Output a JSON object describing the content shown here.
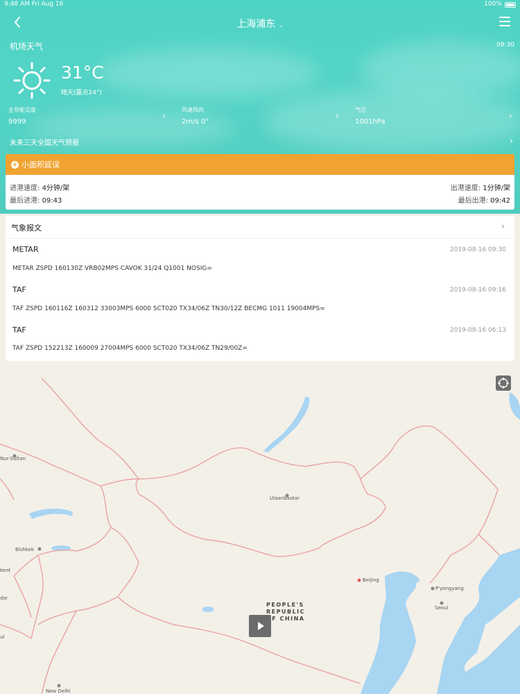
{
  "status_bar": {
    "time_date": "9:48 AM   Fri Aug 16",
    "battery": "100%"
  },
  "header": {
    "title": "上海浦东",
    "section_label": "机场天气",
    "update_time": "09:30"
  },
  "weather": {
    "temperature": "31°C",
    "condition": "晴天(露点24°)",
    "icon": "sun-icon",
    "metrics": [
      {
        "label": "主导能见度",
        "value": "9999"
      },
      {
        "label": "风速风向",
        "value": "2m/s 0°"
      },
      {
        "label": "气压",
        "value": "1001hPa"
      }
    ],
    "forecast_link": "未来三天全国天气预报"
  },
  "delay": {
    "title": "小面积延误",
    "arr_speed_label": "进港速度:",
    "arr_speed_value": "4分钟/架",
    "dep_speed_label": "出港速度:",
    "dep_speed_value": "1分钟/架",
    "last_arr_label": "最后进港:",
    "last_arr_value": "09:43",
    "last_dep_label": "最后出港:",
    "last_dep_value": "09:42",
    "accent": "#f0a331"
  },
  "metar": {
    "title": "气象报文",
    "reports": [
      {
        "type": "METAR",
        "time": "2019-08-16 09:30",
        "text": "METAR ZSPD 160130Z VRB02MPS CAVOK 31/24 Q1001 NOSIG="
      },
      {
        "type": "TAF",
        "time": "2019-08-16 09:16",
        "text": "TAF ZSPD 160116Z 160312 33003MPS 6000 SCT020 TX34/06Z TN30/12Z BECMG  1011 19004MPS="
      },
      {
        "type": "TAF",
        "time": "2019-08-16 06:13",
        "text": "TAF ZSPD 152213Z 160009 27004MPS 6000 SCT020 TX34/06Z TN29/00Z="
      }
    ]
  },
  "map": {
    "cities": {
      "nur_sultan": "Nur-Sultan",
      "ulaanbaatar": "Ulaanbaatar",
      "bishkek": "Bishkek",
      "tashkent": "kent",
      "beijing": "Beijing",
      "pyongyang": "P'yongyang",
      "seoul": "Seoul",
      "new_delhi": "New Delhi",
      "dushanbe": "ıbe",
      "kabul": "ul"
    },
    "country_line1": "PEOPLE'S",
    "country_line2": "REPUBLIC",
    "country_line3": "OF CHINA"
  },
  "colors": {
    "header_teal": "#53d4c6",
    "delay_orange": "#f0a331",
    "map_land": "#f3f0e8",
    "map_water": "#a8d5f2",
    "border_pink": "#e9a2a2"
  }
}
